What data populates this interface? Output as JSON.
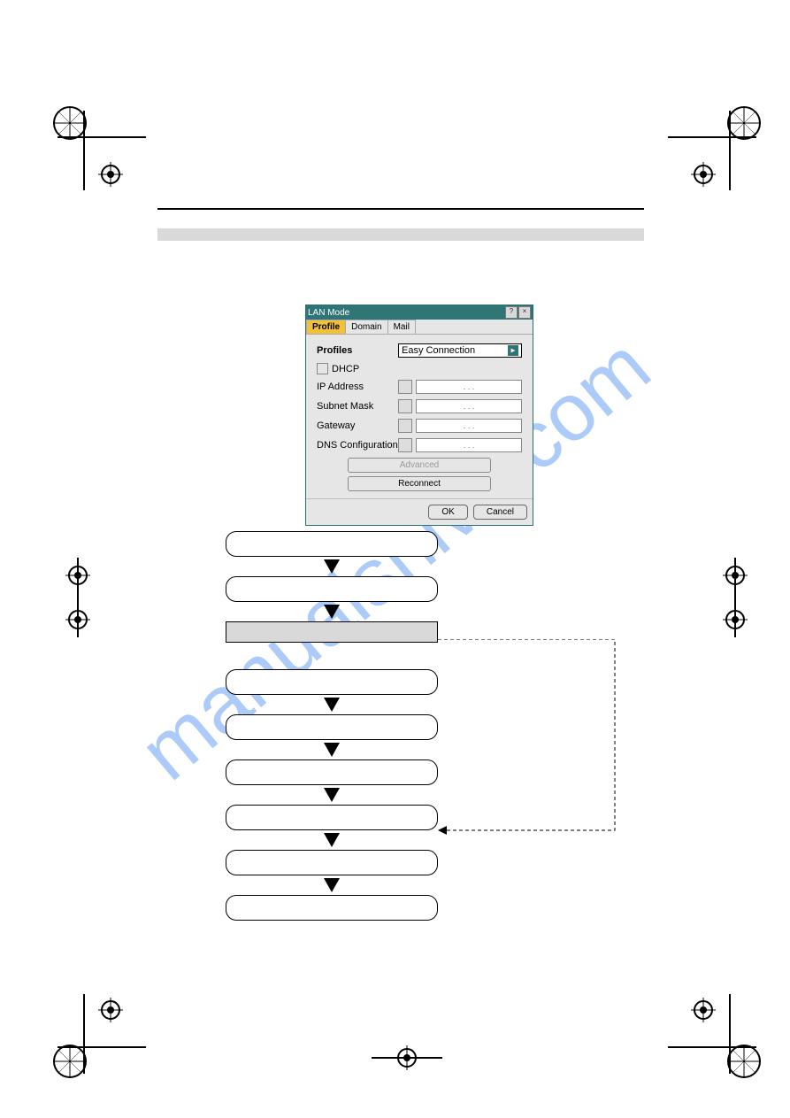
{
  "watermark": "manualshive.com",
  "dialog": {
    "title": "LAN Mode",
    "tabs": {
      "profile": "Profile",
      "domain": "Domain",
      "mail": "Mail"
    },
    "profiles_label": "Profiles",
    "profiles_value": "Easy Connection",
    "dhcp_label": "DHCP",
    "ip_label": "IP Address",
    "subnet_label": "Subnet Mask",
    "gateway_label": "Gateway",
    "dns_label": "DNS Configuration",
    "ip_placeholder": ".   .   .",
    "advanced_label": "Advanced",
    "reconnect_label": "Reconnect",
    "ok_label": "OK",
    "cancel_label": "Cancel"
  }
}
